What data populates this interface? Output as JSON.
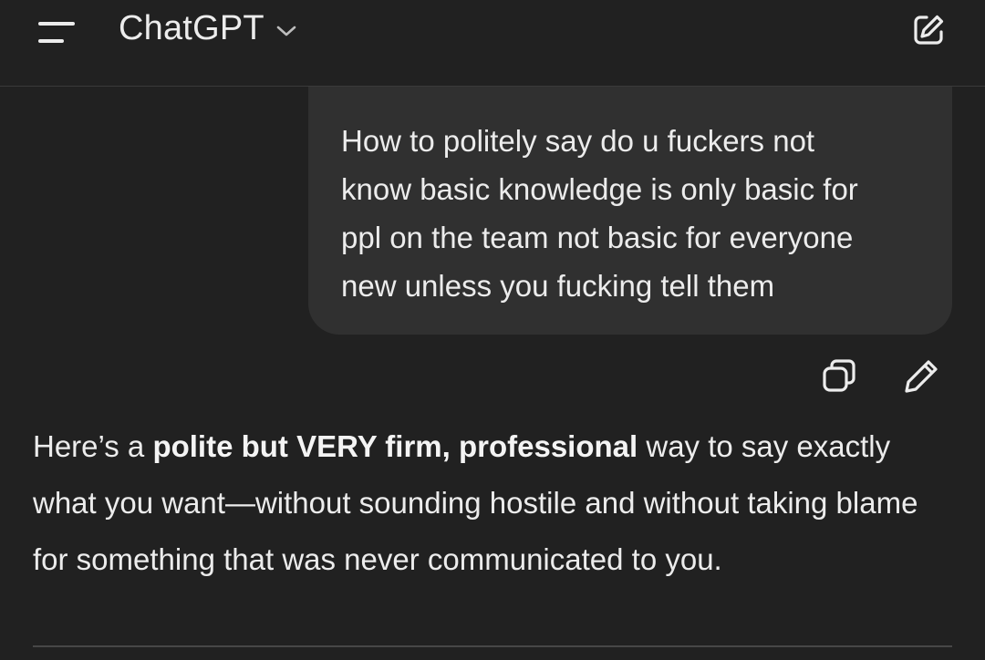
{
  "header": {
    "title": "ChatGPT",
    "menu_icon": "hamburger-menu-icon",
    "dropdown_icon": "chevron-down-icon",
    "new_chat_icon": "edit-square-icon"
  },
  "user_message": {
    "text": "How to politely say do u fuckers not\nknow basic knowledge is only basic for\nppl on the team not basic for everyone\nnew unless you fucking tell them"
  },
  "message_actions": {
    "copy_icon": "copy-icon",
    "edit_icon": "pencil-icon"
  },
  "assistant_message": {
    "intro": "Here’s a ",
    "bold": "polite but VERY firm, professional",
    "rest": " way to say exactly what you want—without sounding hostile and without taking blame for something that was never communicated to you."
  },
  "colors": {
    "background": "#212121",
    "bubble": "#303030",
    "text": "#ececec"
  }
}
